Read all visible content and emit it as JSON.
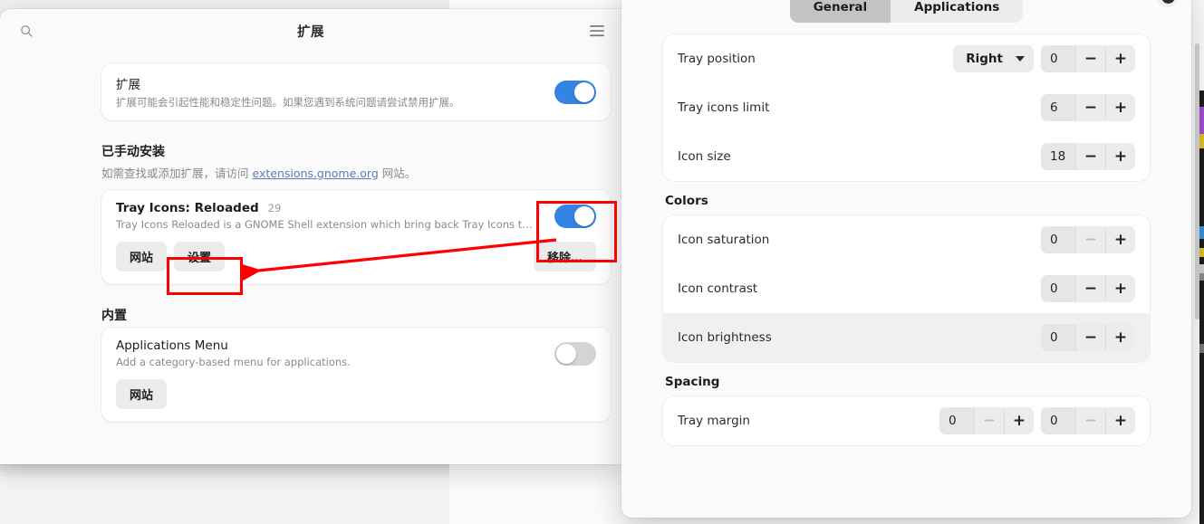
{
  "left_window": {
    "title": "扩展",
    "search_icon": "search-icon",
    "menu_icon": "hamburger-menu-icon",
    "global_card": {
      "title": "扩展",
      "subtitle": "扩展可能会引起性能和稳定性问题。如果您遇到系统问题请尝试禁用扩展。",
      "toggle_on": true
    },
    "manual_section": {
      "heading": "已手动安装",
      "desc_before": "如需查找或添加扩展，请访问 ",
      "link": "extensions.gnome.org",
      "desc_after": " 网站。",
      "extension": {
        "name": "Tray Icons: Reloaded",
        "count": "29",
        "description": "Tray Icons Reloaded is a GNOME Shell extension which bring back Tray Icons to top panel, with …",
        "toggle_on": true,
        "buttons": {
          "website": "网站",
          "settings": "设置",
          "remove": "移除…"
        }
      }
    },
    "builtin_section": {
      "heading": "内置",
      "extension": {
        "name": "Applications Menu",
        "description": "Add a category-based menu for applications.",
        "toggle_on": false,
        "buttons": {
          "website": "网站"
        }
      }
    }
  },
  "right_window": {
    "tabs": [
      {
        "label": "General",
        "active": true
      },
      {
        "label": "Applications",
        "active": false
      }
    ],
    "close_icon": "close-circle-icon",
    "groups": [
      {
        "heading": "",
        "rows": [
          {
            "label": "Tray position",
            "dropdown": {
              "value": "Right",
              "icon": "chevron-down-icon"
            },
            "spinners": [
              {
                "value": "0",
                "minus_enabled": true,
                "plus_enabled": true
              }
            ],
            "highlighted": false
          },
          {
            "label": "Tray icons limit",
            "spinners": [
              {
                "value": "6",
                "minus_enabled": true,
                "plus_enabled": true
              }
            ],
            "highlighted": false
          },
          {
            "label": "Icon size",
            "spinners": [
              {
                "value": "18",
                "minus_enabled": true,
                "plus_enabled": true
              }
            ],
            "highlighted": false
          }
        ]
      },
      {
        "heading": "Colors",
        "rows": [
          {
            "label": "Icon saturation",
            "spinners": [
              {
                "value": "0",
                "minus_enabled": false,
                "plus_enabled": true
              }
            ],
            "highlighted": false
          },
          {
            "label": "Icon contrast",
            "spinners": [
              {
                "value": "0",
                "minus_enabled": true,
                "plus_enabled": true
              }
            ],
            "highlighted": false
          },
          {
            "label": "Icon brightness",
            "spinners": [
              {
                "value": "0",
                "minus_enabled": true,
                "plus_enabled": true
              }
            ],
            "highlighted": true
          }
        ]
      },
      {
        "heading": "Spacing",
        "rows": [
          {
            "label": "Tray margin",
            "spinners": [
              {
                "value": "0",
                "minus_enabled": false,
                "plus_enabled": true
              },
              {
                "value": "0",
                "minus_enabled": false,
                "plus_enabled": true
              }
            ],
            "highlighted": false
          }
        ]
      }
    ]
  },
  "annotations": {
    "color": "#ff0000",
    "boxes": [
      {
        "name": "toggle-highlight"
      },
      {
        "name": "settings-button-highlight"
      }
    ],
    "arrow": {
      "from": "extension-toggle",
      "to": "settings-button"
    }
  },
  "colors": {
    "accent": "#3584e4",
    "annotation": "#ff0000",
    "window_bg": "#fafafa",
    "card_bg": "#ffffff"
  }
}
